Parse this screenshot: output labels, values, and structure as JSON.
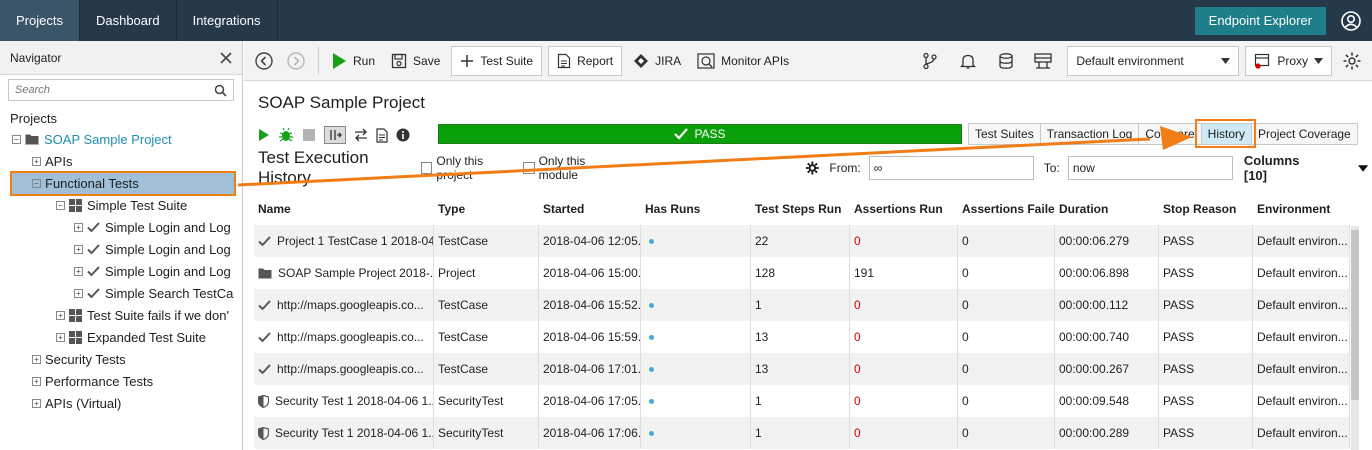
{
  "topbar": {
    "tabs": [
      {
        "label": "Projects",
        "active": true
      },
      {
        "label": "Dashboard",
        "active": false
      },
      {
        "label": "Integrations",
        "active": false
      }
    ],
    "endpoint_explorer": "Endpoint Explorer"
  },
  "navigator": {
    "title": "Navigator",
    "search_placeholder": "Search",
    "projects_label": "Projects",
    "tree": [
      {
        "label": "SOAP Sample Project",
        "level": 0,
        "icon": "folder-icon",
        "expander": "−"
      },
      {
        "label": "APIs",
        "level": 1,
        "icon": "",
        "expander": "+"
      },
      {
        "label": "Functional Tests",
        "level": 1,
        "icon": "",
        "expander": "−",
        "selected": true
      },
      {
        "label": "Simple Test Suite",
        "level": 2,
        "icon": "suite-icon",
        "expander": "−"
      },
      {
        "label": "Simple Login and Log",
        "level": 3,
        "icon": "check-icon",
        "expander": "+"
      },
      {
        "label": "Simple Login and Log",
        "level": 3,
        "icon": "check-icon",
        "expander": "+"
      },
      {
        "label": "Simple Login and Log",
        "level": 3,
        "icon": "check-icon",
        "expander": "+"
      },
      {
        "label": "Simple Search TestCa",
        "level": 3,
        "icon": "check-icon",
        "expander": "+"
      },
      {
        "label": "Test Suite fails if we don'",
        "level": 2,
        "icon": "suite-icon",
        "expander": "+"
      },
      {
        "label": "Expanded Test Suite",
        "level": 2,
        "icon": "suite-icon",
        "expander": "+"
      },
      {
        "label": "Security Tests",
        "level": 1,
        "icon": "",
        "expander": "+"
      },
      {
        "label": "Performance Tests",
        "level": 1,
        "icon": "",
        "expander": "+"
      },
      {
        "label": "APIs (Virtual)",
        "level": 1,
        "icon": "",
        "expander": "+"
      }
    ]
  },
  "toolbar": {
    "run": "Run",
    "save": "Save",
    "test_suite": "Test Suite",
    "report": "Report",
    "jira": "JIRA",
    "monitor_apis": "Monitor APIs",
    "environment": "Default environment",
    "proxy": "Proxy"
  },
  "project": {
    "title": "SOAP Sample Project",
    "status": "PASS",
    "view_tabs": [
      {
        "label": "Test Suites",
        "active": false
      },
      {
        "label": "Transaction Log",
        "active": false
      },
      {
        "label": "Compare",
        "active": false
      },
      {
        "label": "History",
        "active": true
      },
      {
        "label": "Project Coverage",
        "active": false
      }
    ]
  },
  "history": {
    "title": "Test Execution History",
    "only_this_project": "Only this project",
    "only_this_module": "Only this module",
    "from_label": "From:",
    "from_value": "∞",
    "to_label": "To:",
    "to_value": "now",
    "columns_label": "Columns [10]",
    "headers": [
      "Name",
      "Type",
      "Started",
      "Has Runs",
      "Test Steps Run",
      "Assertions Run",
      "Assertions Failed",
      "Duration",
      "Stop Reason",
      "Environment"
    ],
    "rows": [
      {
        "icon": "check-icon",
        "name": "Project 1 TestCase 1 2018-04...",
        "type": "TestCase",
        "started": "2018-04-06 12:05...",
        "has_runs": true,
        "steps": "22",
        "assertions": "0",
        "failed": "0",
        "duration": "00:00:06.279",
        "stop": "PASS",
        "env": "Default environ..."
      },
      {
        "icon": "folder-icon",
        "name": "SOAP Sample Project 2018-...",
        "type": "Project",
        "started": "2018-04-06 15:00...",
        "has_runs": false,
        "steps": "128",
        "assertions": "191",
        "failed": "0",
        "duration": "00:00:06.898",
        "stop": "PASS",
        "env": "Default environ..."
      },
      {
        "icon": "check-icon",
        "name": "http://maps.googleapis.co...",
        "type": "TestCase",
        "started": "2018-04-06 15:52...",
        "has_runs": true,
        "steps": "1",
        "assertions": "0",
        "failed": "0",
        "duration": "00:00:00.112",
        "stop": "PASS",
        "env": "Default environ..."
      },
      {
        "icon": "check-icon",
        "name": "http://maps.googleapis.co...",
        "type": "TestCase",
        "started": "2018-04-06 15:59...",
        "has_runs": true,
        "steps": "13",
        "assertions": "0",
        "failed": "0",
        "duration": "00:00:00.740",
        "stop": "PASS",
        "env": "Default environ..."
      },
      {
        "icon": "check-icon",
        "name": "http://maps.googleapis.co...",
        "type": "TestCase",
        "started": "2018-04-06 17:01...",
        "has_runs": true,
        "steps": "13",
        "assertions": "0",
        "failed": "0",
        "duration": "00:00:00.267",
        "stop": "PASS",
        "env": "Default environ..."
      },
      {
        "icon": "shield-icon",
        "name": "Security Test 1 2018-04-06 1...",
        "type": "SecurityTest",
        "started": "2018-04-06 17:05...",
        "has_runs": true,
        "steps": "1",
        "assertions": "0",
        "failed": "0",
        "duration": "00:00:09.548",
        "stop": "PASS",
        "env": "Default environ..."
      },
      {
        "icon": "shield-icon",
        "name": "Security Test 1 2018-04-06 1...",
        "type": "SecurityTest",
        "started": "2018-04-06 17:06...",
        "has_runs": true,
        "steps": "1",
        "assertions": "0",
        "failed": "0",
        "duration": "00:00:00.289",
        "stop": "PASS",
        "env": "Default environ..."
      }
    ]
  },
  "colors": {
    "topbar": "#253949",
    "accent_teal": "#1e7e8a",
    "pass_green": "#0aa00a",
    "highlight_orange": "#f07d16",
    "selected_node": "#9fc0d8",
    "failed_red": "#d40000"
  }
}
